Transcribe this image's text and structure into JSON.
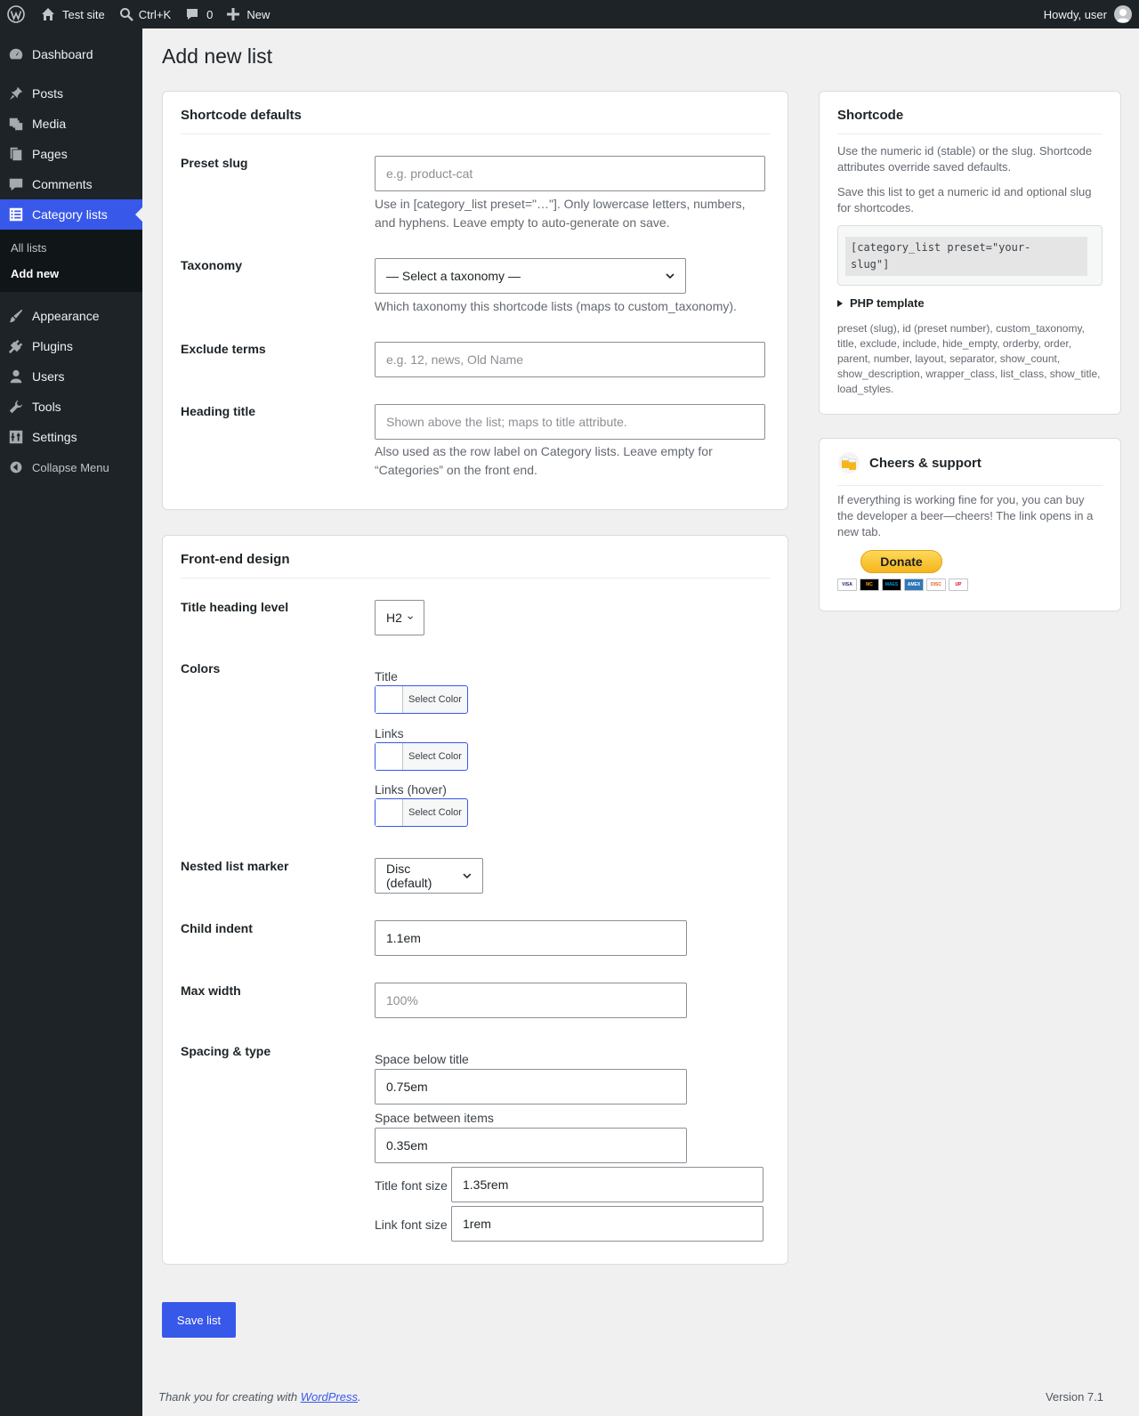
{
  "adminbar": {
    "site_name": "Test site",
    "search_shortcut": "Ctrl+K",
    "comments_count": "0",
    "new_label": "New",
    "howdy": "Howdy, user"
  },
  "sidebar": {
    "items": [
      {
        "label": "Dashboard",
        "icon": "dashboard-icon"
      },
      {
        "label": "Posts",
        "icon": "pin-icon"
      },
      {
        "label": "Media",
        "icon": "media-icon"
      },
      {
        "label": "Pages",
        "icon": "pages-icon"
      },
      {
        "label": "Comments",
        "icon": "comment-icon"
      },
      {
        "label": "Category lists",
        "icon": "list-icon"
      },
      {
        "label": "Appearance",
        "icon": "brush-icon"
      },
      {
        "label": "Plugins",
        "icon": "plugin-icon"
      },
      {
        "label": "Users",
        "icon": "user-icon"
      },
      {
        "label": "Tools",
        "icon": "wrench-icon"
      },
      {
        "label": "Settings",
        "icon": "settings-icon"
      }
    ],
    "submenu": [
      "All lists",
      "Add new"
    ],
    "collapse": "Collapse Menu"
  },
  "page": {
    "title": "Add new list"
  },
  "shortcode_defaults": {
    "heading": "Shortcode defaults",
    "preset_slug": {
      "label": "Preset slug",
      "placeholder": "e.g. product-cat",
      "desc_line1": "Use in [category_list preset=\"…\"]. Only lowercase letters, numbers,",
      "desc_line2": "and hyphens. Leave empty to auto-generate on save."
    },
    "taxonomy": {
      "label": "Taxonomy",
      "selected": "— Select a taxonomy —",
      "desc": "Which taxonomy this shortcode lists (maps to custom_taxonomy)."
    },
    "exclude_terms": {
      "label": "Exclude terms",
      "placeholder": "e.g. 12, news, Old Name"
    },
    "heading_title": {
      "label": "Heading title",
      "placeholder": "Shown above the list; maps to title attribute.",
      "desc_line1": "Also used as the row label on Category lists. Leave empty for",
      "desc_line2": "“Categories” on the front end."
    }
  },
  "frontend_design": {
    "heading": "Front-end design",
    "title_heading_level": {
      "label": "Title heading level",
      "selected": "H2"
    },
    "colors": {
      "label": "Colors",
      "items": [
        {
          "label": "Title",
          "button": "Select Color"
        },
        {
          "label": "Links",
          "button": "Select Color"
        },
        {
          "label": "Links (hover)",
          "button": "Select Color"
        }
      ]
    },
    "nested_marker": {
      "label": "Nested list marker",
      "selected": "Disc (default)"
    },
    "child_indent": {
      "label": "Child indent",
      "value": "1.1em"
    },
    "max_width": {
      "label": "Max width",
      "placeholder": "100%"
    },
    "spacing": {
      "label": "Spacing & type",
      "space_below_title": {
        "label": "Space below title",
        "value": "0.75em"
      },
      "space_between_items": {
        "label": "Space between items",
        "value": "0.35em"
      },
      "title_font_size": {
        "label": "Title font size",
        "value": "1.35rem"
      },
      "link_font_size": {
        "label": "Link font size",
        "value": "1rem"
      }
    }
  },
  "save_button": "Save list",
  "shortcode_box": {
    "heading": "Shortcode",
    "text1_line1": "Use the numeric id (stable) or the slug. Shortcode",
    "text1_line2": "attributes override saved defaults.",
    "text2_line1": "Save this list to get a numeric id and optional slug",
    "text2_line2": "for shortcodes.",
    "code_line1": "[category_list preset=\"your-",
    "code_line2": "slug\"]",
    "php_template": "PHP template",
    "attrs_lines": [
      "preset (slug), id (preset number), custom_taxonomy,",
      "title, exclude, include, hide_empty, orderby, order,",
      "parent, number, layout, separator, show_count,",
      "show_description, wrapper_class, list_class, show_title,",
      "load_styles."
    ]
  },
  "support_box": {
    "heading": "Cheers & support",
    "text_lines": [
      "If everything is working fine for you, you can buy",
      "the developer a beer—cheers! The link opens in a",
      "new tab."
    ],
    "donate": "Donate",
    "card_brands": [
      "VISA",
      "MC",
      "MAES",
      "AMEX",
      "DISC",
      "UP"
    ]
  },
  "footer": {
    "text": "Thank you for creating with ",
    "link": "WordPress",
    "period": ".",
    "version": "Version 7.1"
  },
  "colors": {
    "accent": "#3858e9",
    "adminbar": "#1d2327",
    "background": "#f0f0f1"
  }
}
